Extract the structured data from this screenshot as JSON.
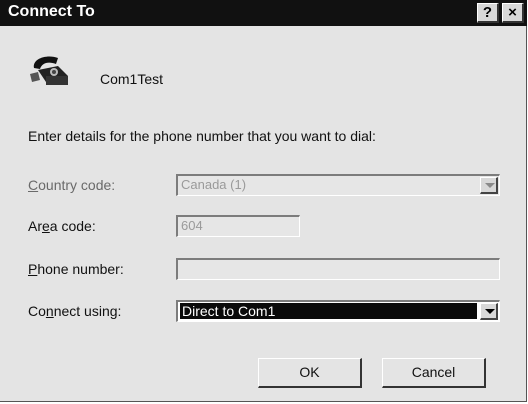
{
  "window": {
    "title": "Connect To"
  },
  "titlebar": {
    "help_label": "?",
    "close_label": "×"
  },
  "connection": {
    "name": "Com1Test"
  },
  "prompt": "Enter details for the phone number that you want to dial:",
  "fields": {
    "country": {
      "label_pre": "",
      "label_key": "C",
      "label_post": "ountry code:",
      "value": "Canada (1)",
      "enabled": false
    },
    "area": {
      "label_pre": "Ar",
      "label_key": "e",
      "label_post": "a code:",
      "value": "604",
      "enabled": false
    },
    "phone": {
      "label_pre": "",
      "label_key": "P",
      "label_post": "hone number:",
      "value": "",
      "enabled": false
    },
    "connect": {
      "label_pre": "Co",
      "label_key": "n",
      "label_post": "nect using:",
      "value": "Direct to Com1",
      "enabled": true
    }
  },
  "buttons": {
    "ok": "OK",
    "cancel": "Cancel"
  },
  "icons": {
    "phone": "telephone-icon",
    "dropdown": "chevron-down-icon"
  },
  "colors": {
    "titlebar": "#111111",
    "dialog": "#e4e4e4",
    "selection": "#0a0a0a"
  }
}
